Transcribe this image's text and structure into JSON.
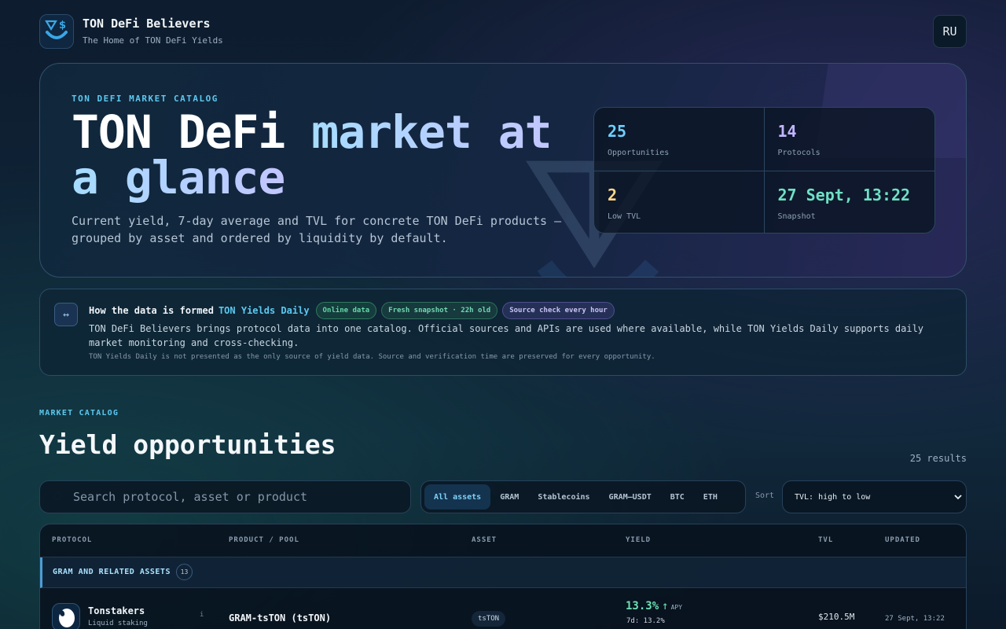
{
  "header": {
    "brand_title": "TON DeFi Believers",
    "brand_subtitle": "The Home of TON DeFi Yields",
    "lang_button": "RU"
  },
  "hero": {
    "eyebrow": "TON DEFI MARKET CATALOG",
    "title_part1": "TON DeFi ",
    "title_accent": "market at",
    "title_part2": "a glance",
    "description": "Current yield, 7-day average and TVL for concrete TON DeFi products — grouped by asset and ordered by liquidity by default.",
    "stats": [
      {
        "value": "25",
        "label": "Opportunities",
        "color": "#6fd0ff"
      },
      {
        "value": "14",
        "label": "Protocols",
        "color": "#c2b5ff"
      },
      {
        "value": "2",
        "label": "Low TVL",
        "color": "#ffd98a"
      },
      {
        "value": "27 Sept, 13:22",
        "label": "Snapshot",
        "color": "#6ee0c4"
      }
    ]
  },
  "info": {
    "icon": "↔",
    "title": "How the data is formed",
    "link": "TON Yields Daily",
    "badges": [
      "Online data",
      "Fresh snapshot · 22h old",
      "Source check every hour"
    ],
    "body": "TON DeFi Believers brings protocol data into one catalog. Official sources and APIs are used where available, while TON Yields Daily supports daily market monitoring and cross-checking.",
    "note": "TON Yields Daily is not presented as the only source of yield data. Source and verification time are preserved for every opportunity."
  },
  "catalog": {
    "eyebrow": "MARKET CATALOG",
    "title": "Yield opportunities",
    "count": "25 results",
    "search_placeholder": "Search protocol, asset or product",
    "filters": [
      "All assets",
      "GRAM",
      "Stablecoins",
      "GRAM–USDT",
      "BTC",
      "ETH"
    ],
    "active_filter": 0,
    "sort_label": "Sort",
    "sort_value": "TVL: high to low"
  },
  "table": {
    "headers": [
      "PROTOCOL",
      "PRODUCT / POOL",
      "ASSET",
      "YIELD",
      "TVL",
      "UPDATED"
    ],
    "group": {
      "label": "GRAM AND RELATED ASSETS",
      "count": "13"
    },
    "rows": [
      {
        "protocol": "Tonstakers",
        "protocol_sub": "Liquid staking",
        "info_icon": "i",
        "product": "GRAM-tsTON (tsTON)",
        "asset": "tsTON",
        "yield": "13.3%",
        "yield_arrow": "↑",
        "yield_unit": "APY",
        "yield_7d": "7d: 13.2%",
        "tvl": "$210.5M",
        "updated": "27 Sept, 13:22"
      }
    ]
  }
}
